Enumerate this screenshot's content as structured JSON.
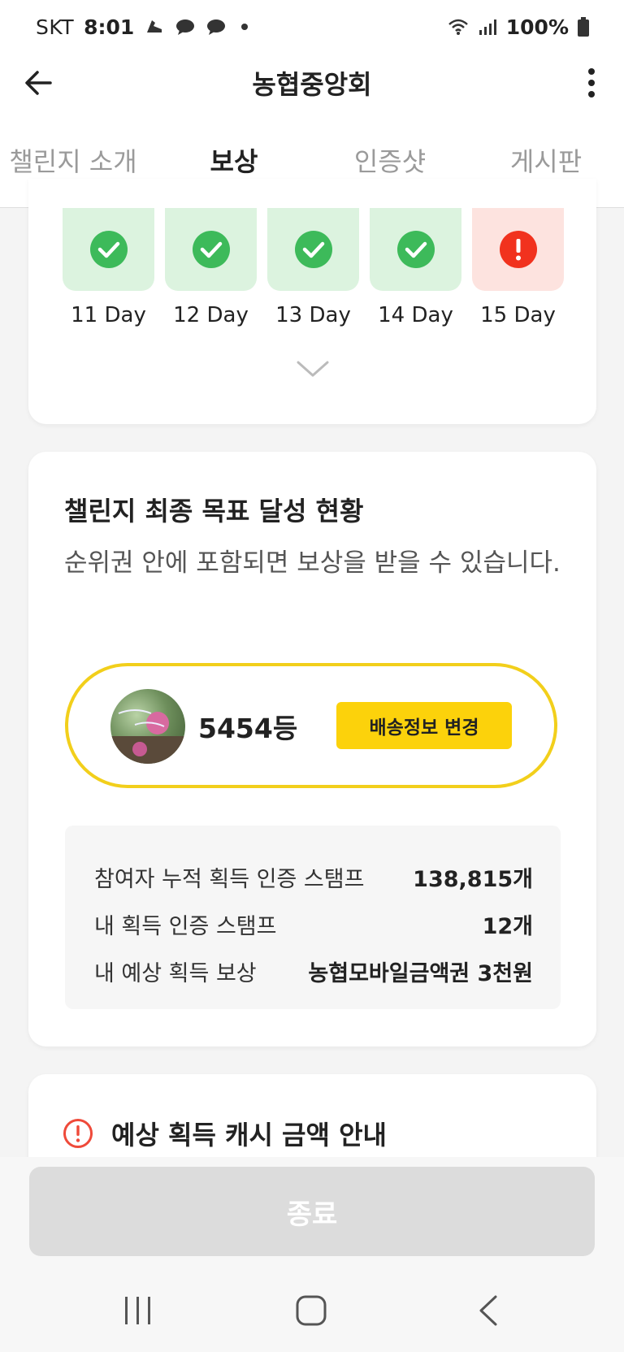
{
  "status_bar": {
    "carrier": "SKT",
    "time": "8:01",
    "battery": "100%",
    "icons": [
      "shoe-icon",
      "chat-icon",
      "chat-icon",
      "dot-icon",
      "wifi-icon",
      "signal-icon",
      "battery-icon"
    ]
  },
  "header": {
    "title": "농협중앙회",
    "icons": [
      "back-arrow-icon",
      "more-vertical-icon"
    ]
  },
  "tabs": [
    {
      "label": "챌린지 소개",
      "active": false
    },
    {
      "label": "보상",
      "active": true
    },
    {
      "label": "인증샷",
      "active": false
    },
    {
      "label": "게시판",
      "active": false
    }
  ],
  "daily_stamps": [
    {
      "label": "11 Day",
      "status": "done",
      "icon": "check-circle-icon"
    },
    {
      "label": "12 Day",
      "status": "done",
      "icon": "check-circle-icon"
    },
    {
      "label": "13 Day",
      "status": "done",
      "icon": "check-circle-icon"
    },
    {
      "label": "14 Day",
      "status": "done",
      "icon": "check-circle-icon"
    },
    {
      "label": "15 Day",
      "status": "missed",
      "icon": "exclamation-circle-icon"
    }
  ],
  "goal_card": {
    "title": "챌린지 최종 목표 달성 현황",
    "description": "순위권 안에 포함되면 보상을 받을 수 있습니다.",
    "rank": "5454등",
    "shipping_button": "배송정보 변경",
    "stats": [
      {
        "label": "참여자 누적 획득 인증 스탬프",
        "value": "138,815개"
      },
      {
        "label": "내 획득 인증 스탬프",
        "value": "12개"
      },
      {
        "label": "내 예상 획득 보상",
        "value": "농협모바일금액권 3천원"
      }
    ]
  },
  "notice_card": {
    "title": "예상 획득 캐시 금액 안내",
    "icon": "alert-circle-icon"
  },
  "end_button": "종료",
  "colors": {
    "accent_yellow": "#fcd20b",
    "check_green": "#3dba5a",
    "alert_red": "#f1321e",
    "done_bg": "#dcf3df",
    "missed_bg": "#fde3df"
  },
  "nav_bar": [
    "recent-apps-icon",
    "home-icon",
    "back-icon"
  ]
}
